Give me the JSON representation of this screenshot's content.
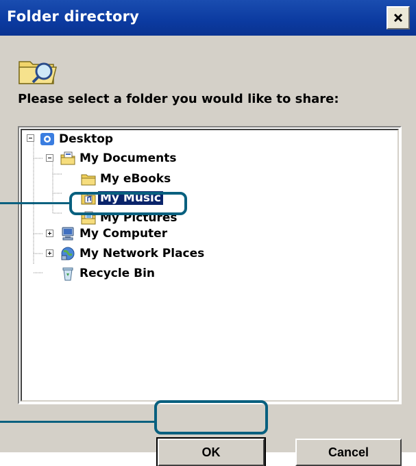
{
  "window": {
    "title": "Folder directory"
  },
  "dialog": {
    "prompt": "Please select a folder you would like to share:"
  },
  "tree": [
    {
      "label": "Desktop",
      "icon": "desktop-icon"
    },
    {
      "label": "My Documents",
      "icon": "my-documents-icon"
    },
    {
      "label": "My eBooks",
      "icon": "folder-icon"
    },
    {
      "label": "My Music",
      "icon": "music-folder-icon",
      "selected": true
    },
    {
      "label": "My Pictures",
      "icon": "pictures-folder-icon"
    },
    {
      "label": "My Computer",
      "icon": "computer-icon"
    },
    {
      "label": "My Network Places",
      "icon": "network-places-icon"
    },
    {
      "label": "Recycle Bin",
      "icon": "recycle-bin-icon"
    }
  ],
  "buttons": {
    "ok": "OK",
    "cancel": "Cancel"
  },
  "colors": {
    "titlebar": "#0b3aa0",
    "dialog": "#d4d0c8",
    "selection": "#0a246a",
    "callout": "#08607f"
  }
}
